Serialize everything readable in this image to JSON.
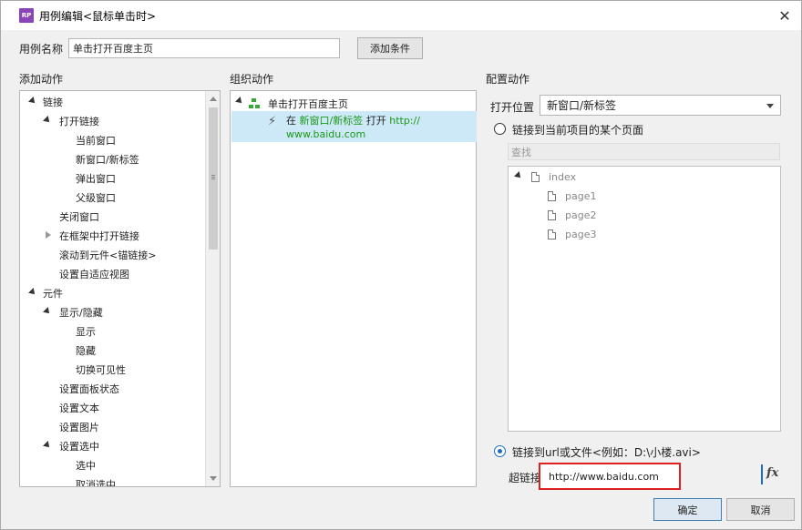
{
  "window": {
    "app_icon_text": "RP",
    "title": "用例编辑<鼠标单击时>",
    "close_label": "✕"
  },
  "usecase": {
    "label": "用例名称",
    "value": "单击打开百度主页",
    "add_condition_label": "添加条件"
  },
  "sections": {
    "add_action": "添加动作",
    "organize_action": "组织动作",
    "configure_action": "配置动作"
  },
  "left_tree": [
    {
      "label": "链接"
    },
    {
      "label": "打开链接"
    },
    {
      "label": "当前窗口"
    },
    {
      "label": "新窗口/新标签"
    },
    {
      "label": "弹出窗口"
    },
    {
      "label": "父级窗口"
    },
    {
      "label": "关闭窗口"
    },
    {
      "label": "在框架中打开链接"
    },
    {
      "label": "滚动到元件<锚链接>"
    },
    {
      "label": "设置自适应视图"
    },
    {
      "label": "元件"
    },
    {
      "label": "显示/隐藏"
    },
    {
      "label": "显示"
    },
    {
      "label": "隐藏"
    },
    {
      "label": "切换可见性"
    },
    {
      "label": "设置面板状态"
    },
    {
      "label": "设置文本"
    },
    {
      "label": "设置图片"
    },
    {
      "label": "设置选中"
    },
    {
      "label": "选中"
    },
    {
      "label": "取消选中"
    }
  ],
  "middle": {
    "case_label": "单击打开百度主页",
    "action_prefix": "在",
    "action_target": "新窗口/新标签",
    "action_verb": "打开",
    "action_url_line1": "http://",
    "action_url_line2": "www.baidu.com"
  },
  "right": {
    "open_position_label": "打开位置",
    "open_position_value": "新窗口/新标签",
    "radio_page_label": "链接到当前项目的某个页面",
    "find_placeholder": "查找",
    "pages": [
      {
        "label": "index"
      },
      {
        "label": "page1"
      },
      {
        "label": "page2"
      },
      {
        "label": "page3"
      }
    ],
    "radio_url_label": "链接到url或文件<例如：D:\\小楼.avi>",
    "url_label": "超链接",
    "url_value": "http://www.baidu.com",
    "fx_label": "fx"
  },
  "footer": {
    "ok_label": "确定",
    "cancel_label": "取消"
  },
  "colors": {
    "highlight": "#cde8f7",
    "green_text": "#1a9a1a",
    "annotation_red": "#e02020",
    "app_icon": "#8a44b8"
  }
}
